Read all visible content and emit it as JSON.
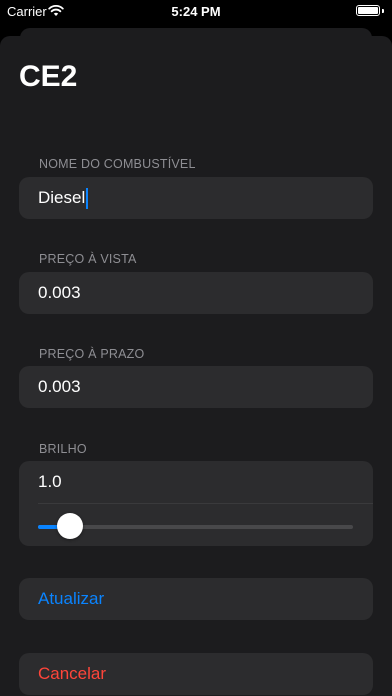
{
  "status_bar": {
    "carrier": "Carrier",
    "time": "5:24 PM",
    "icons": [
      "wifi-icon",
      "battery-icon"
    ]
  },
  "page": {
    "title": "CE2"
  },
  "fuel_name": {
    "header": "NOME DO COMBUSTÍVEL",
    "value": "Diesel"
  },
  "cash_price": {
    "header": "PREÇO À VISTA",
    "value": "0.003"
  },
  "term_price": {
    "header": "PREÇO À PRAZO",
    "value": "0.003"
  },
  "brightness": {
    "header": "BRILHO",
    "value": "1.0",
    "slider_fraction": 0.1
  },
  "actions": {
    "update_label": "Atualizar",
    "cancel_label": "Cancelar"
  },
  "colors": {
    "accent": "#0a84ff",
    "destructive": "#ff453a",
    "background": "#000000",
    "sheet": "#1c1c1e",
    "cell": "#2c2c2e",
    "secondary_text": "#8e8e93"
  }
}
